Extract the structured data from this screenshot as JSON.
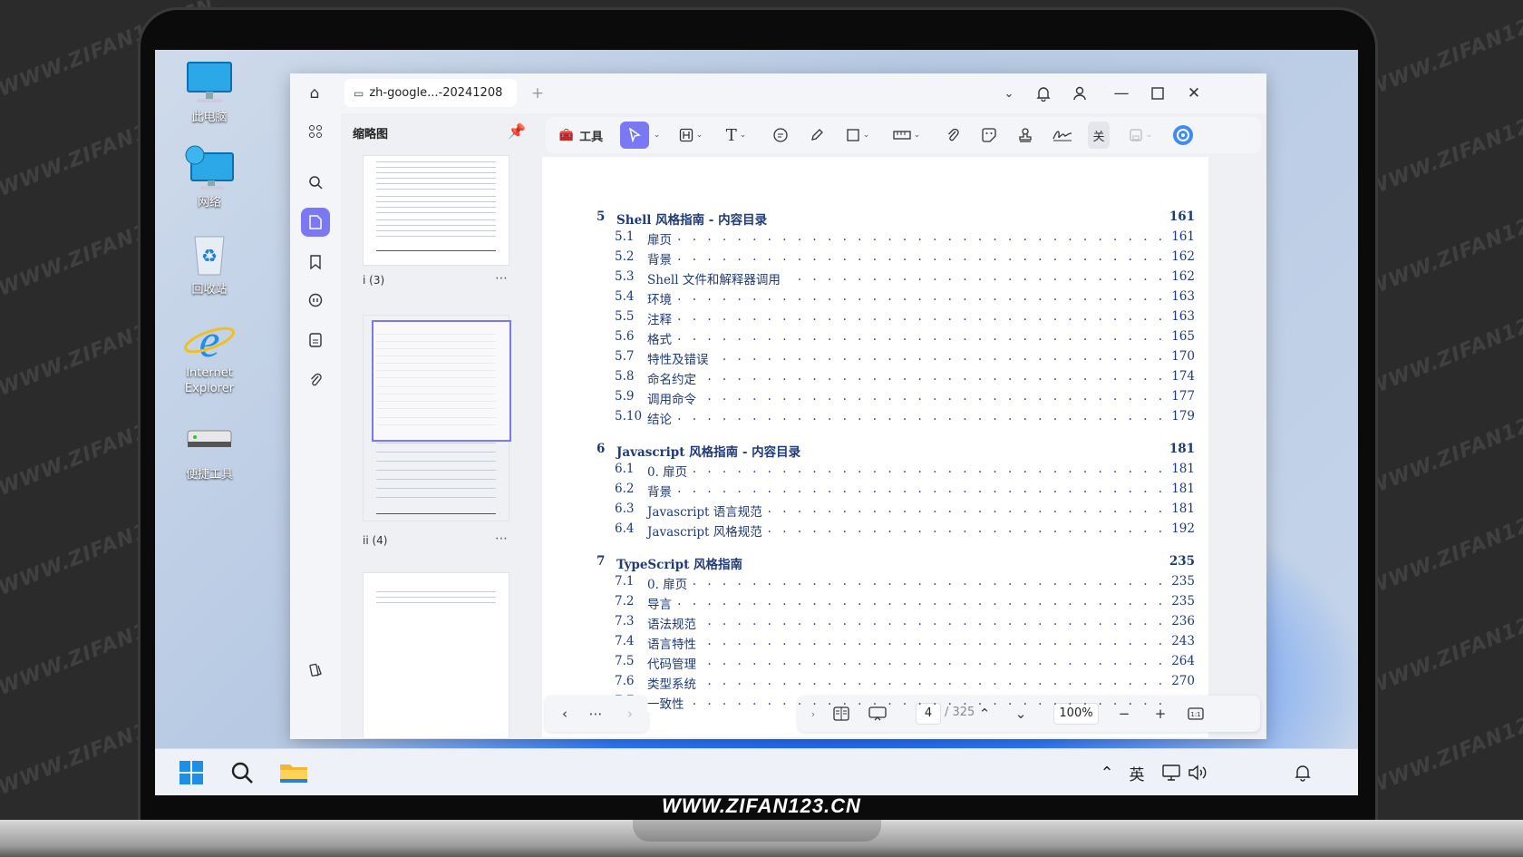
{
  "watermark": "WWW.ZIFAN123.CN",
  "laptop_brand": "WWW.ZIFAN123.CN",
  "desktop": {
    "icons": [
      {
        "label": "此电脑",
        "icon": "monitor-icon"
      },
      {
        "label": "网络",
        "icon": "network-icon"
      },
      {
        "label": "回收站",
        "icon": "recycle-bin-icon"
      },
      {
        "label": "Internet Explorer",
        "icon": "ie-icon"
      },
      {
        "label": "便捷工具",
        "icon": "drive-icon"
      }
    ]
  },
  "taskbar": {
    "tray_ime": "英"
  },
  "app": {
    "tab_title": "zh-google...-20241208",
    "thumbnails_title": "缩略图",
    "thumbs": [
      {
        "caption": "i (3)"
      },
      {
        "caption": "ii (4)"
      },
      {
        "caption": ""
      }
    ],
    "toolbar": {
      "tools_label": "工具",
      "close_label": "关"
    },
    "nav": {
      "current_page": "4",
      "total_pages": "/ 325",
      "zoom": "100%"
    }
  },
  "toc": [
    {
      "num": "5",
      "title": "Shell 风格指南 - 内容目录",
      "page": "161",
      "items": [
        {
          "num": "5.1",
          "title": "扉页",
          "page": "161"
        },
        {
          "num": "5.2",
          "title": "背景",
          "page": "162"
        },
        {
          "num": "5.3",
          "title": "Shell 文件和解释器调用",
          "page": "162"
        },
        {
          "num": "5.4",
          "title": "环境",
          "page": "163"
        },
        {
          "num": "5.5",
          "title": "注释",
          "page": "163"
        },
        {
          "num": "5.6",
          "title": "格式",
          "page": "165"
        },
        {
          "num": "5.7",
          "title": "特性及错误",
          "page": "170"
        },
        {
          "num": "5.8",
          "title": "命名约定",
          "page": "174"
        },
        {
          "num": "5.9",
          "title": "调用命令",
          "page": "177"
        },
        {
          "num": "5.10",
          "title": "结论",
          "page": "179"
        }
      ]
    },
    {
      "num": "6",
      "title": "Javascript 风格指南 - 内容目录",
      "page": "181",
      "items": [
        {
          "num": "6.1",
          "title": "0. 扉页",
          "page": "181"
        },
        {
          "num": "6.2",
          "title": "背景",
          "page": "181"
        },
        {
          "num": "6.3",
          "title": "Javascript 语言规范",
          "page": "181"
        },
        {
          "num": "6.4",
          "title": "Javascript 风格规范",
          "page": "192"
        }
      ]
    },
    {
      "num": "7",
      "title": "TypeScript 风格指南",
      "page": "235",
      "items": [
        {
          "num": "7.1",
          "title": "0. 扉页",
          "page": "235"
        },
        {
          "num": "7.2",
          "title": "导言",
          "page": "235"
        },
        {
          "num": "7.3",
          "title": "语法规范",
          "page": "236"
        },
        {
          "num": "7.4",
          "title": "语言特性",
          "page": "243"
        },
        {
          "num": "7.5",
          "title": "代码管理",
          "page": "264"
        },
        {
          "num": "7.6",
          "title": "类型系统",
          "page": "270"
        },
        {
          "num": "7.7",
          "title": "一致性",
          "page": ""
        }
      ]
    }
  ]
}
